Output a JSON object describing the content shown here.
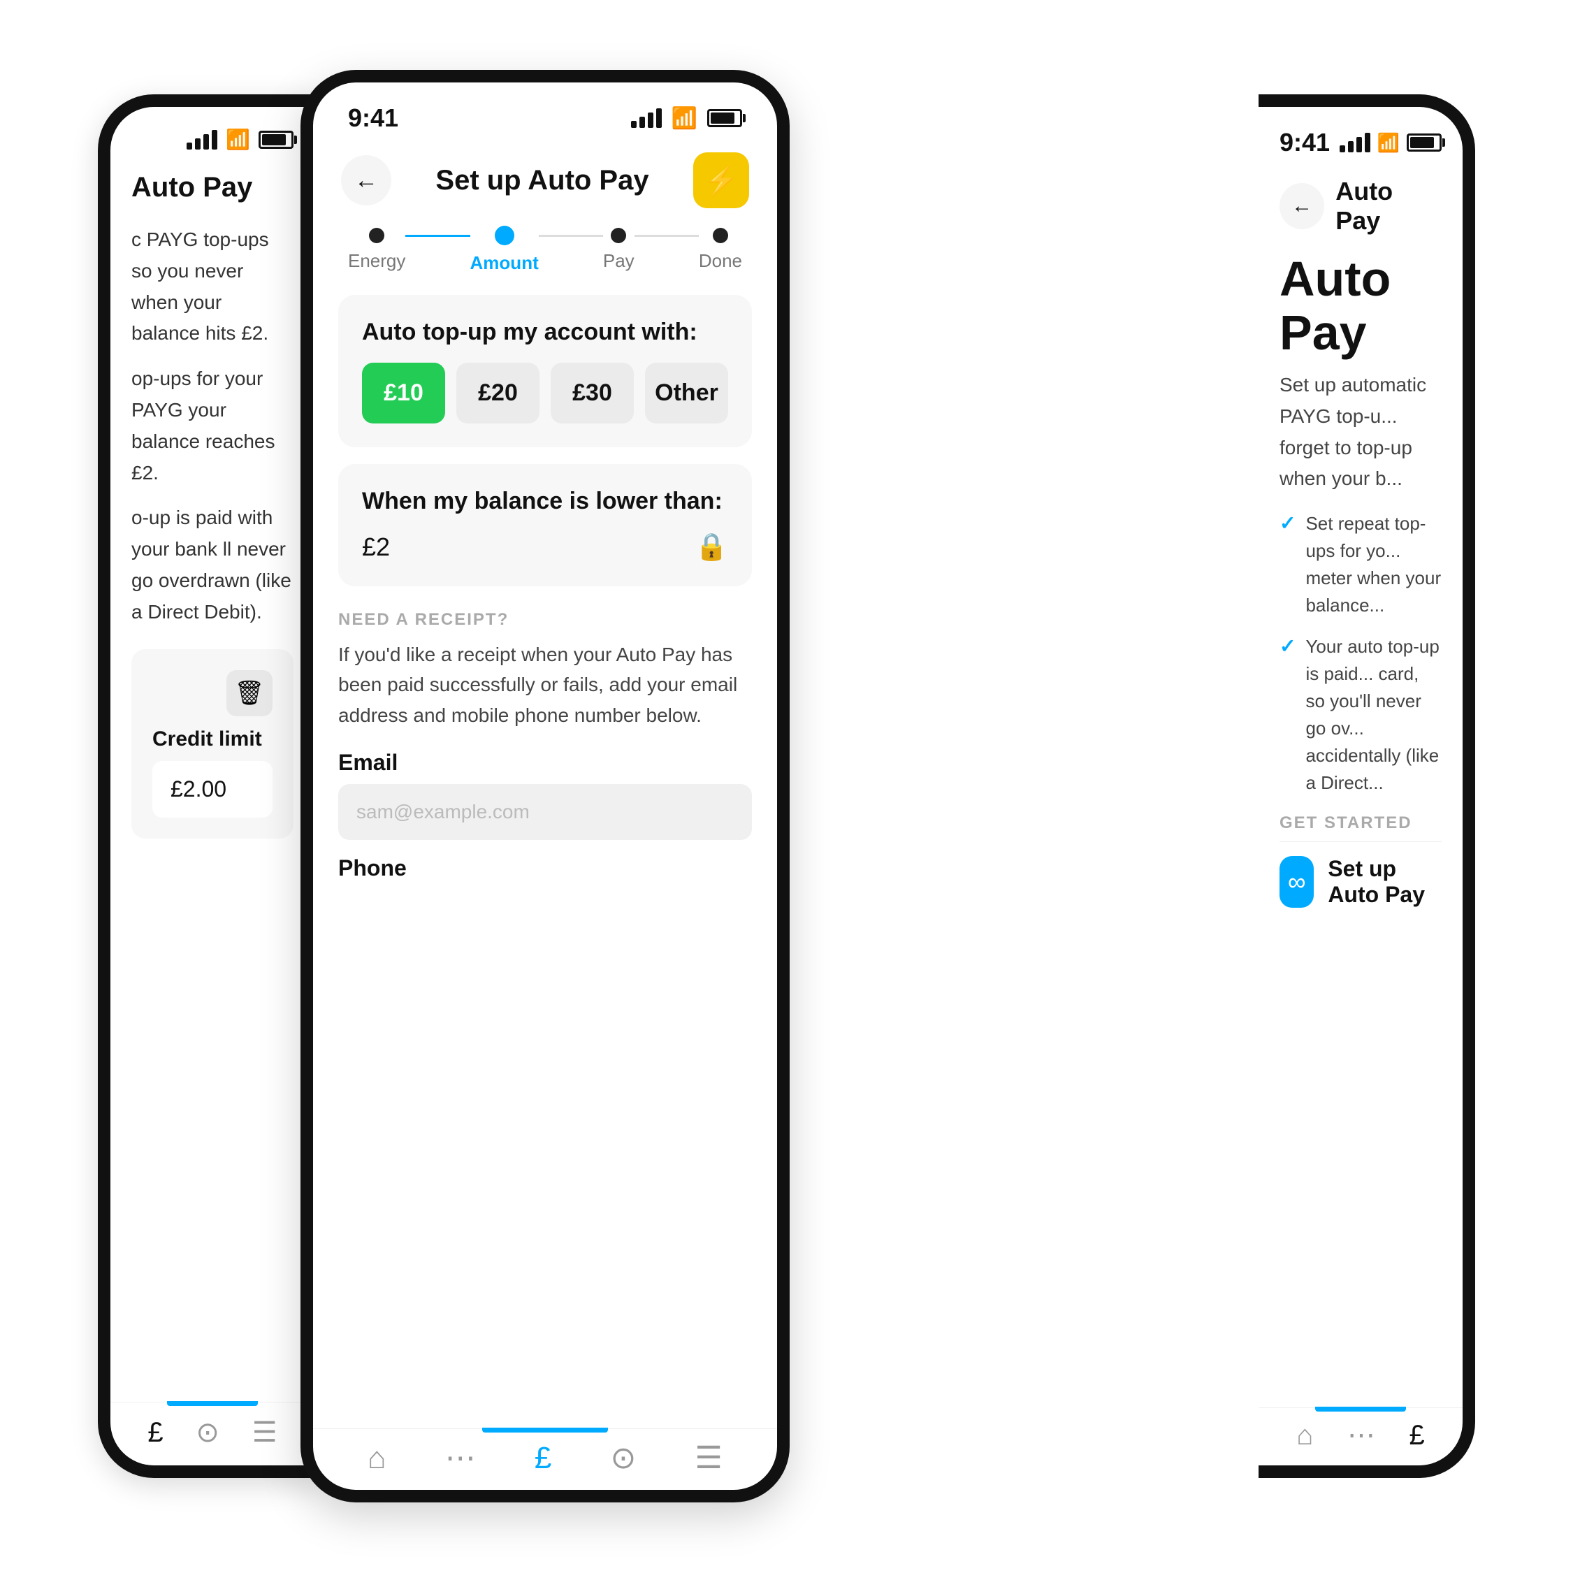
{
  "scene": {
    "bg_color": "#ffffff"
  },
  "left_phone": {
    "status": {
      "time": "",
      "show_time": false
    },
    "title": "Auto Pay",
    "body_text_1": "c PAYG top-ups so you never when your balance hits £2.",
    "body_text_2": "op-ups for your PAYG your balance reaches £2.",
    "body_text_3": "o-up is paid with your bank ll never go overdrawn (like a Direct Debit).",
    "credit_section": {
      "trash_label": "trash",
      "credit_limit_label": "Credit limit",
      "credit_value": "£2.00"
    },
    "bottom_nav": {
      "icons": [
        "£",
        "?",
        "≡"
      ]
    }
  },
  "middle_phone": {
    "status": {
      "time": "9:41"
    },
    "header": {
      "back_label": "←",
      "title": "Set up Auto Pay",
      "action_icon": "⚡"
    },
    "stepper": {
      "steps": [
        {
          "label": "Energy",
          "state": "completed"
        },
        {
          "label": "Amount",
          "state": "active"
        },
        {
          "label": "Pay",
          "state": "default"
        },
        {
          "label": "Done",
          "state": "default"
        }
      ]
    },
    "top_card": {
      "title": "Auto top-up my account with:",
      "amounts": [
        {
          "value": "£10",
          "selected": true
        },
        {
          "value": "£20",
          "selected": false
        },
        {
          "value": "£30",
          "selected": false
        },
        {
          "value": "Other",
          "selected": false
        }
      ]
    },
    "balance_card": {
      "title": "When my balance is lower than:",
      "value": "£2",
      "lock_icon": "🔒"
    },
    "receipt": {
      "section_label": "NEED A RECEIPT?",
      "description": "If you'd like a receipt when your Auto Pay has been paid successfully or fails, add your email address and mobile phone number below.",
      "email_label": "Email",
      "email_placeholder": "sam@example.com",
      "phone_label": "Phone"
    },
    "bottom_nav": {
      "icons": [
        "⌂",
        "∿",
        "£",
        "?",
        "≡"
      ]
    }
  },
  "right_phone": {
    "status": {
      "time": "9:41"
    },
    "header": {
      "back_label": "←",
      "title": "Auto Pay"
    },
    "hero_title": "Auto Pay",
    "hero_desc": "Set up automatic PAYG top-u... forget to top-up when your b...",
    "check_items": [
      "Set repeat top-ups for yo... meter when your balance...",
      "Your auto top-up is paid... card, so you'll never go ov... accidentally (like a Direct..."
    ],
    "get_started_label": "GET STARTED",
    "setup_btn": {
      "icon": "∞",
      "label": "Set up Auto Pay"
    },
    "bottom_nav": {
      "icons": [
        "⌂",
        "∿",
        "£"
      ]
    }
  }
}
